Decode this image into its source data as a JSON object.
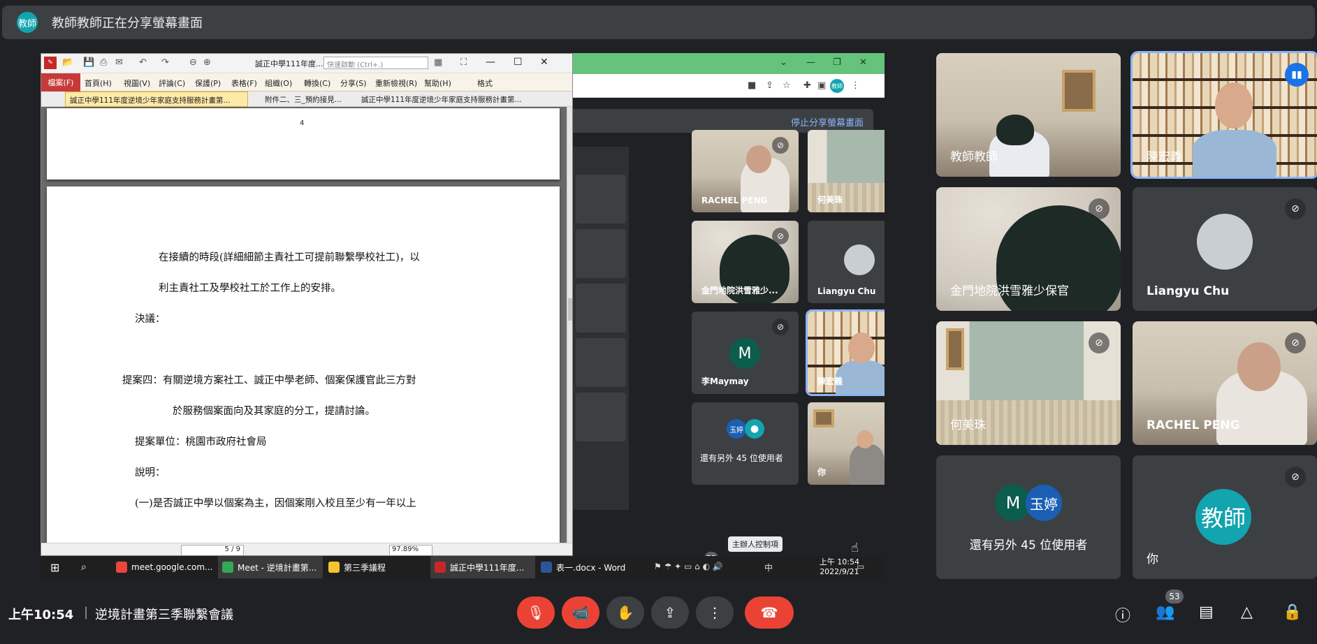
{
  "banner": {
    "avatar": "教師",
    "text": "教師教師正在分享螢幕畫面"
  },
  "pdf_window": {
    "doc_title": "誠正中學111年度...",
    "search_placeholder": "快速啟動 (Ctrl+.)",
    "menu": [
      "檔案(F)",
      "首頁(H)",
      "視圖(V)",
      "評論(C)",
      "保護(P)",
      "表格(F)",
      "組織(O)",
      "轉換(C)",
      "分享(S)",
      "重新檢視(R)",
      "幫助(H)",
      "格式"
    ],
    "tabs": [
      "誠正中學111年度逆境少年家庭支持服務計畫第...",
      "附件二、三_預約接見...",
      "誠正中學111年度逆境少年家庭支持服務計畫第..."
    ],
    "page_number": "4",
    "lines": [
      "在接續的時段(詳細細節主責社工可提前聯繫學校社工)，以",
      "利主責社工及學校社工於工作上的安排。",
      "決議：",
      "提案四：有關逆境方案社工、誠正中學老師、個案保護官此三方對",
      "於服務個案面向及其家庭的分工，提請討論。",
      "提案單位：桃園市政府社會局",
      "說明：",
      "(一)是否誠正中學以個案為主，因個案剛入校且至少有一年以上"
    ],
    "page_field": "5 / 9",
    "zoom": "97.89%"
  },
  "shared_meet": {
    "stop_sharing": "停止分享螢幕畫面",
    "tiles": [
      {
        "name": "RACHEL PENG"
      },
      {
        "name": "何美珠"
      },
      {
        "name": "金門地院洪雪雅少..."
      },
      {
        "name": "Liangyu Chu"
      },
      {
        "name": "李Maymay",
        "avatar": "M"
      },
      {
        "name": "陳宏義"
      },
      {
        "name": "還有另外 45 位使用者",
        "avatar_a": "玉婷"
      },
      {
        "name": "你"
      }
    ],
    "badge": "53",
    "tooltip": "主辦人控制項"
  },
  "taskbar": {
    "items": [
      "meet.google.com...",
      "Meet - 逆境計畫第...",
      "第三季議程",
      "誠正中學111年度...",
      "表一.docx - Word"
    ],
    "tray_ime": "中",
    "clock_time": "上午 10:54",
    "clock_date": "2022/9/21"
  },
  "grid": {
    "tiles": [
      {
        "name": "教師教師"
      },
      {
        "name": "陳宏義"
      },
      {
        "name": "金門地院洪雪雅少保官"
      },
      {
        "name": "Liangyu Chu"
      },
      {
        "name": "何美珠"
      },
      {
        "name": "RACHEL PENG"
      },
      {
        "name": "還有另外 45 位使用者",
        "avatar_a": "M",
        "avatar_b": "玉婷"
      },
      {
        "name": "你",
        "avatar": "教師"
      }
    ]
  },
  "bottom": {
    "time": "上午10:54",
    "separator": "|",
    "meeting_title": "逆境計畫第三季聯繫會議",
    "people_count": "53"
  },
  "colors": {
    "accent": "#8ab4f8",
    "end_call": "#ea4335",
    "avatar_teal": "#12a4af",
    "speaking": "#1a73e8"
  }
}
